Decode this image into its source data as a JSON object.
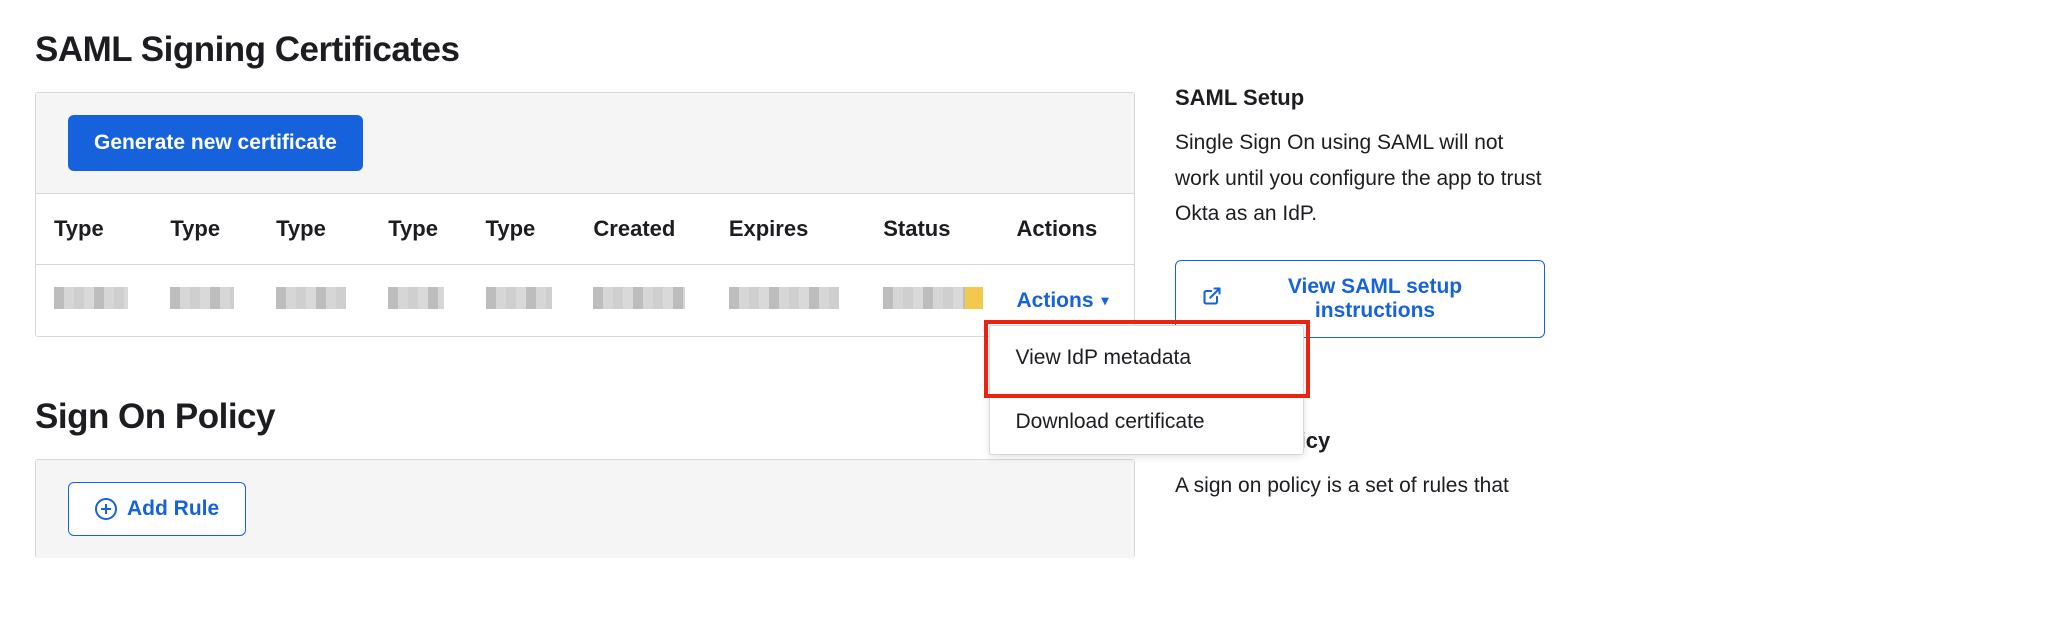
{
  "saml_section": {
    "title": "SAML Signing Certificates",
    "generate_button": "Generate new certificate",
    "table": {
      "headers": [
        "Type",
        "Type",
        "Type",
        "Type",
        "Type",
        "Created",
        "Expires",
        "Status",
        "Actions"
      ],
      "actions_label": "Actions",
      "actions_caret": "▾",
      "dropdown": {
        "view_metadata": "View IdP metadata",
        "download_cert": "Download certificate"
      }
    }
  },
  "sign_on_section": {
    "title": "Sign On Policy",
    "add_rule_button": "Add Rule"
  },
  "sidebar": {
    "saml_setup": {
      "heading": "SAML Setup",
      "text": "Single Sign On using SAML will not work until you configure the app to trust Okta as an IdP.",
      "button_label": "View SAML setup instructions"
    },
    "sign_on_policy": {
      "heading": "Sign On Policy",
      "text": "A sign on policy is a set of rules that"
    }
  }
}
